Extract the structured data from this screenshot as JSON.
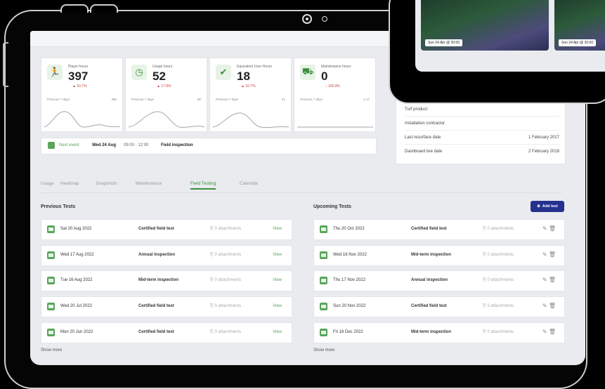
{
  "kpis": [
    {
      "icon": "running-person-icon",
      "label": "Player hours",
      "value": "397",
      "delta": "▲ 10.7%",
      "prev_label": "Previous 7 days",
      "prev_value": "485"
    },
    {
      "icon": "clock-icon",
      "label": "Usage hours",
      "value": "52",
      "delta": "▲ 17.8%",
      "prev_label": "Previous 7 days",
      "prev_value": "80"
    },
    {
      "icon": "shield-check-icon",
      "label": "Equivalent User Hours",
      "value": "18",
      "delta": "▲ 10.7%",
      "prev_label": "Previous 7 days",
      "prev_value": "21"
    },
    {
      "icon": "machine-icon",
      "label": "Maintenance hours",
      "value": "0",
      "delta": "↓ 100.0%",
      "prev_label": "Previous 7 days",
      "prev_value": "1.17"
    }
  ],
  "next_event": {
    "label": "Next event",
    "date": "Wed 24 Aug",
    "time": "09:00 - 12:00",
    "title": "Field inspection"
  },
  "info": [
    {
      "label": "Turf product",
      "value": ""
    },
    {
      "label": "Installation contractor",
      "value": ""
    },
    {
      "label": "Last resurface date",
      "value": "1 February 2017"
    },
    {
      "label": "Dashboard live date",
      "value": "2 February 2018"
    }
  ],
  "tabs": [
    "Usage",
    "Heatmap",
    "Snapshots",
    "Maintenance",
    "Field Testing",
    "Calendar"
  ],
  "active_tab": "Field Testing",
  "previous": {
    "title": "Previous Tests",
    "rows": [
      {
        "date": "Sat 20 Aug 2022",
        "type": "Certified field test",
        "attachments": "0 attachments",
        "action": "View"
      },
      {
        "date": "Wed 17 Aug 2022",
        "type": "Annual inspection",
        "attachments": "0 attachments",
        "action": "View"
      },
      {
        "date": "Tue 16 Aug 2022",
        "type": "Mid-term inspection",
        "attachments": "0 attachments",
        "action": "View"
      },
      {
        "date": "Wed 20 Jul 2022",
        "type": "Certified field test",
        "attachments": "0 attachments",
        "action": "View"
      },
      {
        "date": "Mon 20 Jun 2022",
        "type": "Certified field test",
        "attachments": "0 attachments",
        "action": "View"
      }
    ],
    "show_more": "Show more"
  },
  "upcoming": {
    "title": "Upcoming Tests",
    "add_label": "Add test",
    "rows": [
      {
        "date": "Thu 20 Oct 2022",
        "type": "Certified field test",
        "attachments": "0 attachments"
      },
      {
        "date": "Wed 16 Nov 2022",
        "type": "Mid-term inspection",
        "attachments": "0 attachments"
      },
      {
        "date": "Thu 17 Nov 2022",
        "type": "Annual inspection",
        "attachments": "0 attachments"
      },
      {
        "date": "Sun 20 Nov 2022",
        "type": "Certified field test",
        "attachments": "0 attachments"
      },
      {
        "date": "Fri 16 Dec 2022",
        "type": "Mid-term inspection",
        "attachments": "0 attachments"
      }
    ],
    "show_more": "Show more"
  },
  "snapshots": [
    {
      "caption": "Sun 24 Apr @ 20:00"
    },
    {
      "caption": "Sun 24 Apr @ 20:00"
    }
  ],
  "colors": {
    "accent": "#5aa55c",
    "button": "#25318f",
    "negative": "#d04040"
  }
}
